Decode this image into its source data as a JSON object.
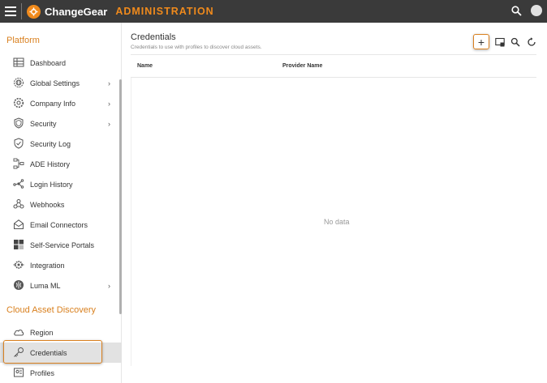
{
  "app": {
    "brand": "ChangeGear",
    "section": "ADMINISTRATION",
    "accent_color": "#f08a1c"
  },
  "sidebar": {
    "groups": [
      {
        "title": "Platform",
        "items": [
          {
            "label": "Dashboard",
            "icon": "table-icon",
            "has_submenu": false
          },
          {
            "label": "Global Settings",
            "icon": "globe-gear-icon",
            "has_submenu": true
          },
          {
            "label": "Company Info",
            "icon": "gear-icon",
            "has_submenu": true
          },
          {
            "label": "Security",
            "icon": "shield-icon",
            "has_submenu": true
          },
          {
            "label": "Security Log",
            "icon": "shield-check-icon",
            "has_submenu": false
          },
          {
            "label": "ADE History",
            "icon": "workflow-icon",
            "has_submenu": false
          },
          {
            "label": "Login History",
            "icon": "network-icon",
            "has_submenu": false
          },
          {
            "label": "Webhooks",
            "icon": "webhook-icon",
            "has_submenu": false
          },
          {
            "label": "Email Connectors",
            "icon": "envelope-open-icon",
            "has_submenu": false
          },
          {
            "label": "Self-Service Portals",
            "icon": "portal-grid-icon",
            "has_submenu": false
          },
          {
            "label": "Integration",
            "icon": "integration-gear-icon",
            "has_submenu": false
          },
          {
            "label": "Luma ML",
            "icon": "brain-icon",
            "has_submenu": true
          }
        ]
      },
      {
        "title": "Cloud Asset Discovery",
        "items": [
          {
            "label": "Region",
            "icon": "cloud-icon",
            "has_submenu": false
          },
          {
            "label": "Credentials",
            "icon": "key-icon",
            "has_submenu": false,
            "active": true
          },
          {
            "label": "Profiles",
            "icon": "profile-icon",
            "has_submenu": false
          }
        ]
      }
    ],
    "chevron": "›"
  },
  "main": {
    "title": "Credentials",
    "subtitle": "Credentials to use with profiles to discover cloud assets.",
    "toolbar": {
      "add_glyph": "+",
      "columns_icon": "column-chooser-icon",
      "search_icon": "search-icon",
      "refresh_icon": "refresh-icon"
    },
    "grid": {
      "columns": [
        "Name",
        "Provider Name"
      ],
      "empty_text": "No data"
    }
  }
}
